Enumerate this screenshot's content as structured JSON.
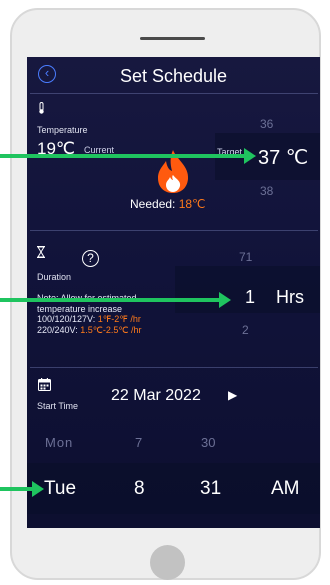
{
  "header": {
    "title": "Set Schedule",
    "back_icon": "‹"
  },
  "temperature": {
    "label": "Temperature",
    "current_value": "19℃",
    "current_label": "Current",
    "target_label": "Target",
    "picker_above": "36",
    "picker_selected": "37 ℃",
    "picker_below": "38",
    "needed_label": "Needed: ",
    "needed_value": "18℃"
  },
  "duration": {
    "label": "Duration",
    "help_icon": "?",
    "note_line1": "Note: Allow for estimated",
    "note_line2": "temperature increase",
    "note_line3_label": "100/120/127V: ",
    "note_line3_value": "1℉-2℉ /hr",
    "note_line4_label": "220/240V: ",
    "note_line4_value": "1.5℃-2.5℃ /hr",
    "picker_above": "71",
    "picker_selected": "1",
    "picker_unit": "Hrs",
    "picker_below": "2"
  },
  "start_time": {
    "label": "Start Time",
    "date": "22 Mar 2022",
    "next_icon": "▶",
    "day_above": "Mon",
    "hour_above": "7",
    "minute_above": "30",
    "day": "Tue",
    "hour": "8",
    "minute": "31",
    "ampm": "AM"
  },
  "colors": {
    "accent_orange": "#ff7a1a",
    "arrow_green": "#1fc45f",
    "back_blue": "#4a7dff"
  }
}
